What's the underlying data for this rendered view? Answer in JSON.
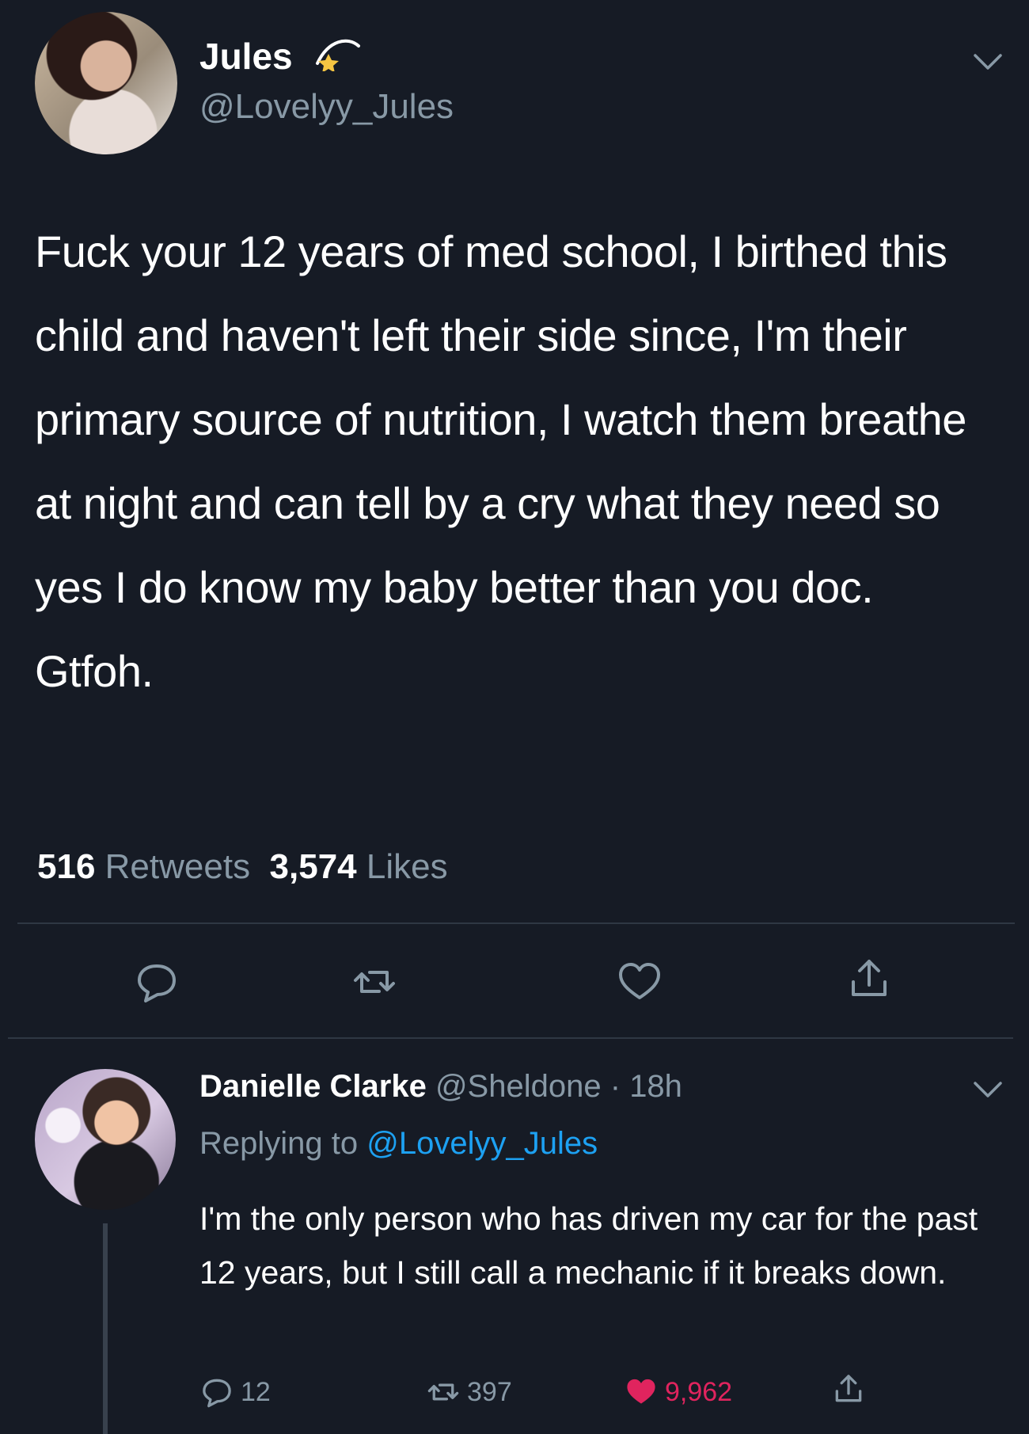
{
  "tweet": {
    "author_name": "Jules",
    "author_handle": "@Lovelyy_Jules",
    "text": "Fuck your 12 years of med school, I birthed this child and haven't left their side since, I'm their primary source of nutrition, I watch them breathe at night and can tell by a cry what they need so yes I do know my baby better than you doc. Gtfoh.",
    "retweets_count": "516",
    "retweets_label": "Retweets",
    "likes_count": "3,574",
    "likes_label": "Likes"
  },
  "reply": {
    "author_name": "Danielle Clarke",
    "author_handle": "@Sheldone",
    "separator": "·",
    "time": "18h",
    "replying_label": "Replying to",
    "replying_handle": "@Lovelyy_Jules",
    "text": "I'm the only person who has driven my car for the past 12 years, but I still call a mechanic if it breaks down.",
    "reply_count": "12",
    "retweet_count": "397",
    "like_count": "9,962"
  },
  "icons": {
    "header_badge": "shooting-star-icon",
    "menu": "chevron-down-icon",
    "reply": "speech-bubble-icon",
    "retweet": "retweet-icon",
    "like": "heart-icon",
    "share": "share-icon"
  },
  "colors": {
    "background": "#161b25",
    "secondary_text": "#8899a6",
    "mention": "#1da1f2",
    "like_active": "#e0245e"
  }
}
